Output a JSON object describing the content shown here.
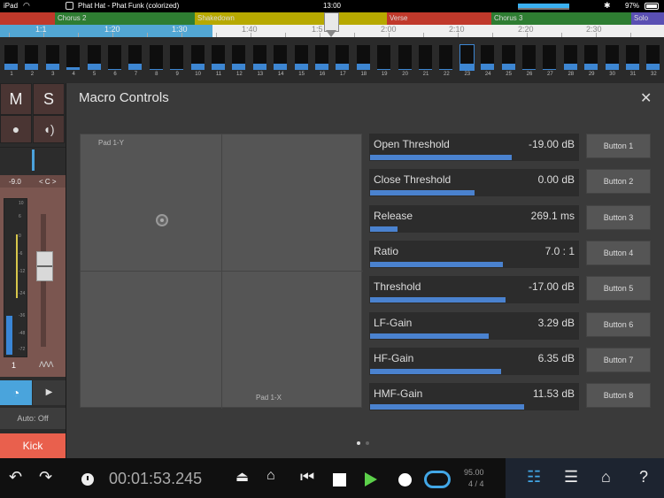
{
  "status_bar": {
    "device": "iPad",
    "title": "Phat Hat - Phat Funk (colorized)",
    "time": "13:00",
    "battery": "97%"
  },
  "markers": [
    {
      "label": "",
      "color": "#c0392b"
    },
    {
      "label": "Chorus 2",
      "color": "#2e7d32"
    },
    {
      "label": "Shakedown",
      "color": "#b7a900"
    },
    {
      "label": "Verse",
      "color": "#c0392b"
    },
    {
      "label": "Chorus 3",
      "color": "#2e7d32"
    },
    {
      "label": "Solo",
      "color": "#5a4fb3"
    }
  ],
  "ruler": {
    "ticks": [
      "1:1",
      "1:20",
      "1:30",
      "1:40",
      "1:5",
      "2:00",
      "2:10",
      "2:20",
      "2:30"
    ]
  },
  "pads": {
    "numbers": [
      "1",
      "2",
      "3",
      "4",
      "5",
      "6",
      "7",
      "8",
      "9",
      "10",
      "11",
      "12",
      "13",
      "14",
      "15",
      "16",
      "17",
      "18",
      "19",
      "20",
      "21",
      "22",
      "23",
      "24",
      "25",
      "26",
      "27",
      "28",
      "29",
      "30",
      "31",
      "32"
    ],
    "levels": [
      0.25,
      0.25,
      0.25,
      0.1,
      0.25,
      0.05,
      0.25,
      0.05,
      0.05,
      0.25,
      0.25,
      0.25,
      0.25,
      0.25,
      0.25,
      0.25,
      0.25,
      0.25,
      0.05,
      0.05,
      0.05,
      0.05,
      0.25,
      0.25,
      0.25,
      0.05,
      0.05,
      0.25,
      0.25,
      0.25,
      0.25,
      0.25
    ],
    "selected": 23
  },
  "channel": {
    "mute": "M",
    "solo": "S",
    "volume": "-9.0",
    "pan": "< C >",
    "meter_scale": [
      "10",
      "6",
      "0",
      "-6",
      "-12",
      "-24",
      "-36",
      "-48",
      "-72"
    ],
    "number": "1",
    "automation": "Auto: Off",
    "name": "Kick"
  },
  "macro": {
    "title": "Macro Controls",
    "pad_y_label": "Pad 1-Y",
    "pad_x_label": "Pad 1-X",
    "params": [
      {
        "name": "Open Threshold",
        "value": "-19.00 dB",
        "level": 0.68
      },
      {
        "name": "Close Threshold",
        "value": "0.00 dB",
        "level": 0.5
      },
      {
        "name": "Release",
        "value": "269.1 ms",
        "level": 0.13
      },
      {
        "name": "Ratio",
        "value": "7.0 : 1",
        "level": 0.64
      },
      {
        "name": "Threshold",
        "value": "-17.00 dB",
        "level": 0.65
      },
      {
        "name": "LF-Gain",
        "value": "3.29 dB",
        "level": 0.57
      },
      {
        "name": "HF-Gain",
        "value": "6.35 dB",
        "level": 0.63
      },
      {
        "name": "HMF-Gain",
        "value": "11.53 dB",
        "level": 0.74
      }
    ],
    "buttons": [
      "Button 1",
      "Button 2",
      "Button 3",
      "Button 4",
      "Button 5",
      "Button 6",
      "Button 7",
      "Button 8"
    ]
  },
  "transport": {
    "time": "00:01:53.245",
    "tempo": "95.00",
    "signature": "4 / 4"
  }
}
